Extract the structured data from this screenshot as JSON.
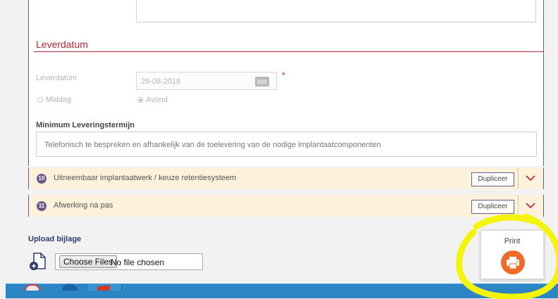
{
  "form": {
    "section_title": "Leverdatum",
    "leverdatum_label": "Leverdatum",
    "leverdatum_value": "29-08-2018",
    "required_mark": "*",
    "radio_middag": "Middag",
    "radio_avond": "Avond",
    "minimum_title": "Minimum Leveringstermijn",
    "minimum_text": "Telefonisch te bespreken en afhankelijk van de toelevering van de nodige implantaatcomponenten"
  },
  "sections": [
    {
      "number": "10",
      "title": "Uitneembaar implantaatwerk / keuze retentiesysteem",
      "button": "Dupliceer"
    },
    {
      "number": "11",
      "title": "Afwerking na pas",
      "button": "Dupliceer"
    }
  ],
  "upload": {
    "title": "Upload bijlage",
    "choose_button": "Choose Files",
    "no_file_text": "No file chosen"
  },
  "print": {
    "label": "Print"
  },
  "colors": {
    "accent_red": "#b0283c",
    "purple": "#6a5a8a",
    "bar_bg": "#fcf2db",
    "print_orange": "#ee6a26",
    "highlight_yellow": "#f4f40a",
    "taskbar": "#2d86c3"
  },
  "icons": {
    "date": "calendar-icon",
    "expand": "chevron-down-icon",
    "upload": "file-add-icon",
    "print": "printer-icon"
  }
}
